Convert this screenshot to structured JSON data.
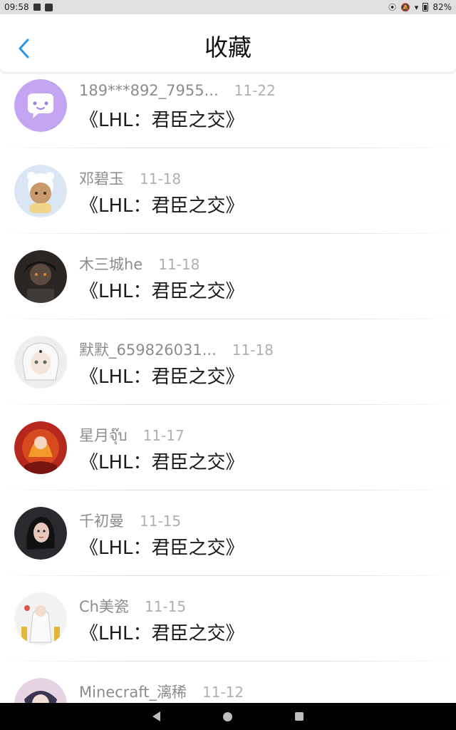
{
  "status_bar": {
    "time": "09:58",
    "battery": "82%"
  },
  "header": {
    "title": "收藏",
    "accent": "#2196F3"
  },
  "items": [
    {
      "name": "189***892_7955...",
      "date": "11-22",
      "content": "《LHL：君臣之交》",
      "avatar": "chat-bubble-avatar"
    },
    {
      "name": "邓碧玉",
      "date": "11-18",
      "content": "《LHL：君臣之交》",
      "avatar": "cartoon-avatar"
    },
    {
      "name": "木三城he",
      "date": "11-18",
      "content": "《LHL：君臣之交》",
      "avatar": "dark-anime-avatar"
    },
    {
      "name": "默默_659826031...",
      "date": "11-18",
      "content": "《LHL：君臣之交》",
      "avatar": "white-hair-anime-avatar"
    },
    {
      "name": "星月จุ๊บ",
      "date": "11-17",
      "content": "《LHL：君臣之交》",
      "avatar": "red-fire-avatar"
    },
    {
      "name": "千初曼",
      "date": "11-15",
      "content": "《LHL：君臣之交》",
      "avatar": "girl-photo-avatar"
    },
    {
      "name": "Ch美瓷",
      "date": "11-15",
      "content": "《LHL：君臣之交》",
      "avatar": "white-robe-avatar"
    },
    {
      "name": "Minecraft_漓稀",
      "date": "11-12",
      "content": "",
      "avatar": "anime-avatar"
    }
  ]
}
